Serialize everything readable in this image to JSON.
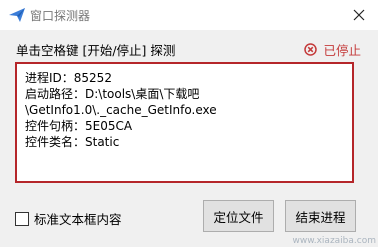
{
  "window": {
    "title": "窗口探测器",
    "icons": {
      "app": "paper-plane-icon",
      "close": "close-icon"
    }
  },
  "main": {
    "hint": "单击空格键 [开始/停止] 探测",
    "status": {
      "text": "已停止",
      "icon": "stop-circle-icon",
      "color": "#c43a3a"
    },
    "info_lines": [
      "进程ID：85252",
      "启动路径：D:\\tools\\桌面\\下载吧",
      "\\GetInfo1.0\\._cache_GetInfo.exe",
      "控件句柄：5E05CA",
      "控件类名：Static"
    ],
    "border_color": "#b5262a"
  },
  "footer": {
    "checkbox_label": "标准文本框内容",
    "checkbox_checked": false,
    "buttons": {
      "locate": "定位文件",
      "end": "结束进程"
    }
  },
  "watermark": "www.xiazaiba.com"
}
